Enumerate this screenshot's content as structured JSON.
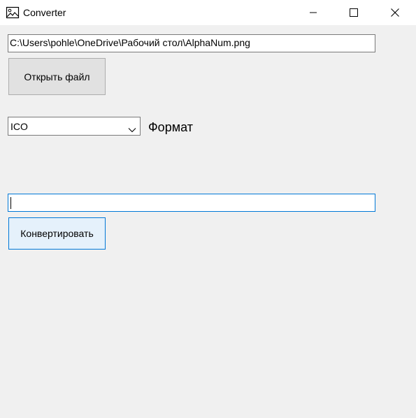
{
  "window": {
    "title": "Converter",
    "icon": "image-file-icon",
    "controls": {
      "minimize": "minimize-icon",
      "maximize": "maximize-icon",
      "close": "close-icon"
    }
  },
  "file": {
    "path_value": "C:\\Users\\pohle\\OneDrive\\Рабочий стол\\AlphaNum.png",
    "open_button_label": "Открыть файл"
  },
  "format": {
    "selected": "ICO",
    "label": "Формат"
  },
  "output": {
    "value": ""
  },
  "convert": {
    "button_label": "Конвертировать"
  },
  "colors": {
    "window_bg": "#f0f0f0",
    "focus_accent": "#0078d7"
  }
}
